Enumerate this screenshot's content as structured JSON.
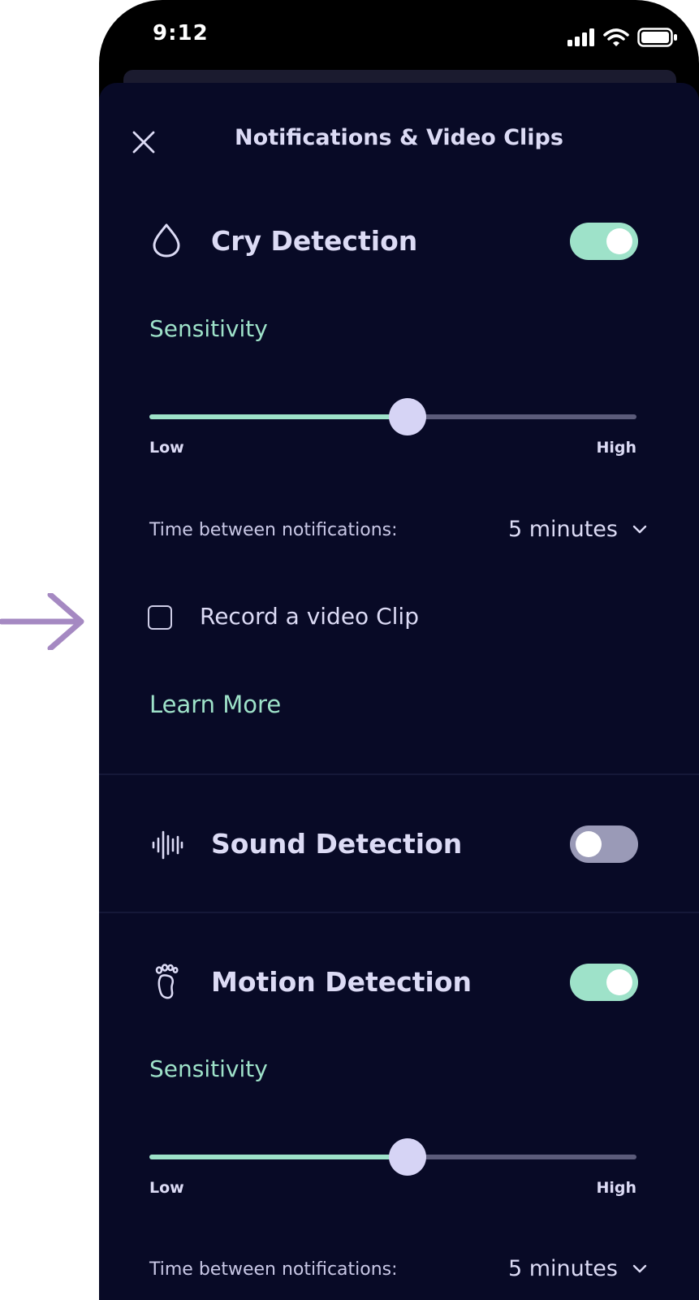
{
  "status_bar": {
    "time": "9:12"
  },
  "header": {
    "title": "Notifications & Video Clips"
  },
  "cry": {
    "title": "Cry Detection",
    "enabled": true,
    "sensitivity_label": "Sensitivity",
    "sensitivity_value": 0.53,
    "low_label": "Low",
    "high_label": "High",
    "tbn_label": "Time between notifications:",
    "tbn_value": "5 minutes",
    "record_label": "Record a video Clip",
    "record_checked": false,
    "learn_more": "Learn More"
  },
  "sound": {
    "title": "Sound Detection",
    "enabled": false
  },
  "motion": {
    "title": "Motion Detection",
    "enabled": true,
    "sensitivity_label": "Sensitivity",
    "sensitivity_value": 0.53,
    "low_label": "Low",
    "high_label": "High",
    "tbn_label": "Time between notifications:",
    "tbn_value": "5 minutes"
  },
  "colors": {
    "accent": "#9ee2c9",
    "background": "#080a26",
    "text": "#dcdbf5",
    "arrow": "#a589c2"
  },
  "icons": [
    "arrow-right-icon",
    "close-icon",
    "drop-icon",
    "soundwave-icon",
    "footprint-icon",
    "chevron-down-icon",
    "signal-icon",
    "wifi-icon",
    "battery-icon"
  ]
}
